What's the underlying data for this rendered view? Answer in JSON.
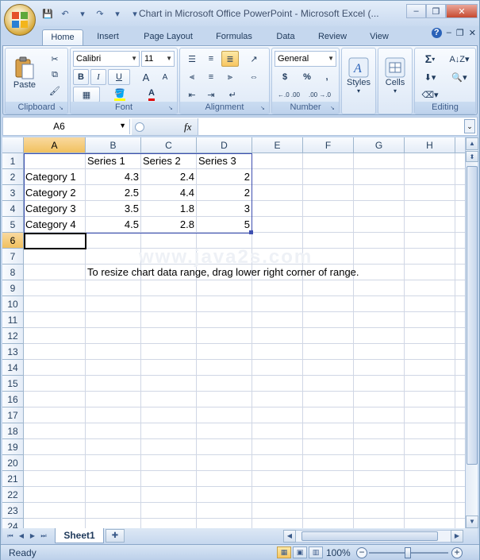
{
  "window": {
    "title": "Chart in Microsoft Office PowerPoint - Microsoft Excel (...",
    "controls": {
      "minimize": "–",
      "restore": "❐",
      "close": "✕"
    }
  },
  "qat": {
    "save": "💾",
    "undo": "↶",
    "redo": "↷",
    "customize": "▾"
  },
  "ribbon_tabs": [
    {
      "label": "Home",
      "active": true
    },
    {
      "label": "Insert",
      "active": false
    },
    {
      "label": "Page Layout",
      "active": false
    },
    {
      "label": "Formulas",
      "active": false
    },
    {
      "label": "Data",
      "active": false
    },
    {
      "label": "Review",
      "active": false
    },
    {
      "label": "View",
      "active": false
    }
  ],
  "ribbon_tab_controls": {
    "help": "?",
    "minimize": "–",
    "restore": "❐",
    "close": "✕"
  },
  "ribbon": {
    "clipboard": {
      "label": "Clipboard",
      "paste": "Paste"
    },
    "font": {
      "label": "Font",
      "family": "Calibri",
      "size": "11",
      "bold": "B",
      "italic": "I",
      "underline": "U",
      "grow": "A",
      "shrink": "A",
      "font_color": "A"
    },
    "alignment": {
      "label": "Alignment"
    },
    "number": {
      "label": "Number",
      "format": "General",
      "currency": "$",
      "percent": "%",
      "comma": ",",
      "inc_dec": "←.0 .00",
      "dec_dec": ".00 →.0"
    },
    "styles": {
      "label": "Styles"
    },
    "cells": {
      "label": "Cells"
    },
    "editing": {
      "label": "Editing",
      "sum": "Σ"
    }
  },
  "formula_bar": {
    "name_box": "A6",
    "fx": "fx",
    "formula": ""
  },
  "columns": [
    "A",
    "B",
    "C",
    "D",
    "E",
    "F",
    "G",
    "H"
  ],
  "rows": [
    "1",
    "2",
    "3",
    "4",
    "5",
    "6",
    "7",
    "8",
    "9",
    "10",
    "11",
    "12",
    "13",
    "14",
    "15",
    "16",
    "17",
    "18",
    "19",
    "20",
    "21",
    "22",
    "23",
    "24"
  ],
  "sheet": {
    "headers": [
      "",
      "Series 1",
      "Series 2",
      "Series 3"
    ],
    "data": [
      [
        "Category 1",
        "4.3",
        "2.4",
        "2"
      ],
      [
        "Category 2",
        "2.5",
        "4.4",
        "2"
      ],
      [
        "Category 3",
        "3.5",
        "1.8",
        "3"
      ],
      [
        "Category 4",
        "4.5",
        "2.8",
        "5"
      ]
    ],
    "note": "To resize chart data range, drag lower right corner of range.",
    "watermark": "www.java2s.com"
  },
  "selection": {
    "active_cell": "A6",
    "active_column": "A",
    "active_row": "6"
  },
  "sheet_tabs": [
    {
      "label": "Sheet1",
      "active": true
    }
  ],
  "status": {
    "ready": "Ready",
    "zoom": "100%",
    "zoom_out": "−",
    "zoom_in": "+"
  },
  "colors": {
    "accent": "#c5d7ee",
    "selection_header": "#f1c15f",
    "range_border": "#3e4fb0"
  }
}
